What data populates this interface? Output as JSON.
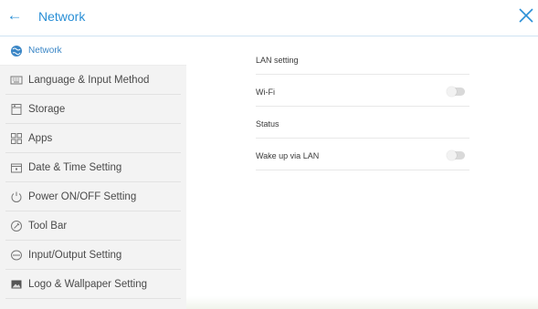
{
  "header": {
    "back_glyph": "←",
    "title": "Network"
  },
  "sidebar": {
    "items": [
      {
        "label": "Network",
        "icon": "globe-icon",
        "active": true
      },
      {
        "label": "Language & Input Method",
        "icon": "keyboard-icon"
      },
      {
        "label": "Storage",
        "icon": "storage-icon"
      },
      {
        "label": "Apps",
        "icon": "apps-grid-icon"
      },
      {
        "label": "Date & Time Setting",
        "icon": "calendar-icon"
      },
      {
        "label": "Power ON/OFF Setting",
        "icon": "power-icon"
      },
      {
        "label": "Tool Bar",
        "icon": "toolbar-icon"
      },
      {
        "label": "Input/Output Setting",
        "icon": "input-output-icon"
      },
      {
        "label": "Logo & Wallpaper Setting",
        "icon": "image-icon"
      }
    ]
  },
  "main": {
    "rows": [
      {
        "label": "LAN setting"
      },
      {
        "label": "Wi-Fi",
        "toggle": false
      },
      {
        "label": "Status"
      },
      {
        "label": "Wake up via LAN",
        "toggle": false
      }
    ]
  },
  "colors": {
    "accent": "#2a8fd6",
    "sidebar_bg": "#f3f3f3"
  }
}
